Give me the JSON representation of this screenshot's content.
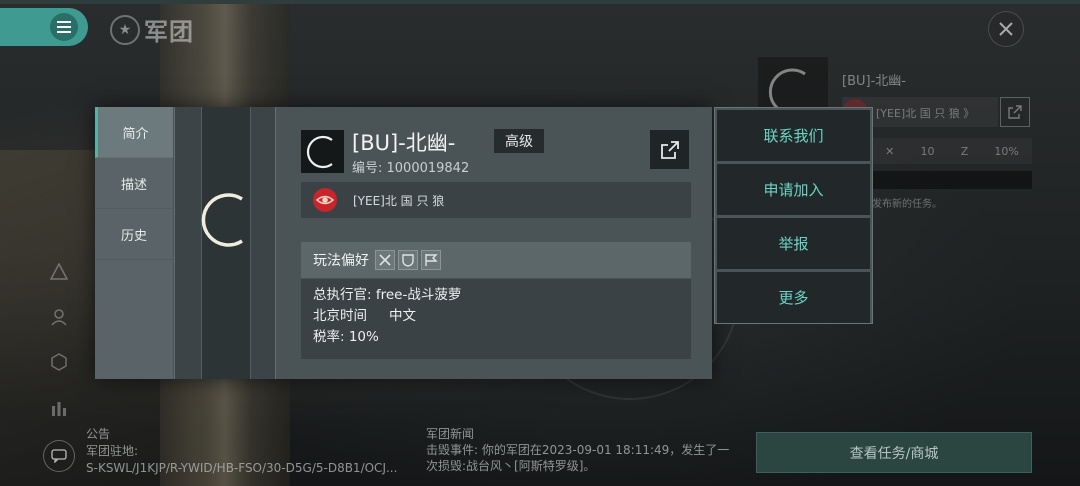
{
  "header": {
    "title": "军团",
    "title_icon": "star-circle-icon"
  },
  "tabs": [
    {
      "label": "简介",
      "active": true
    },
    {
      "label": "描述",
      "active": false
    },
    {
      "label": "历史",
      "active": false
    }
  ],
  "corp": {
    "name": "[BU]-北幽-",
    "level": "高级",
    "id_text": "编号: 1000019842",
    "alliance": "[YEE]北 国 只 狼"
  },
  "preferences": {
    "label": "玩法偏好"
  },
  "info": {
    "ceo": "总执行官: free-战斗菠萝",
    "timezone_label": "北京时间",
    "language": "中文",
    "tax": "税率: 10%"
  },
  "actions": [
    "联系我们",
    "申请加入",
    "举报",
    "更多"
  ],
  "background": {
    "right_name": "[BU]-北幽-",
    "right_alliance": "[YEE]北 国 只 狼 》",
    "stats": [
      "10",
      "10%"
    ],
    "note": "发布新的任务。",
    "task_button": "查看任务/商城",
    "announce_title": "公告",
    "announce_lines": [
      "军团驻地:",
      "S-KSWL/J1KJP/R-YWID/HB-FSO/30-D5G/5-D8B1/OCJ..."
    ],
    "news_title": "军团新闻",
    "news_text": "击毁事件: 你的军团在2023-09-01 18:11:49，发生了一次损毁:战台风丶[阿斯特罗级]。"
  },
  "colors": {
    "accent": "#3f9a92",
    "action_text": "#6cd4c6",
    "alliance_red": "#c8242c"
  }
}
